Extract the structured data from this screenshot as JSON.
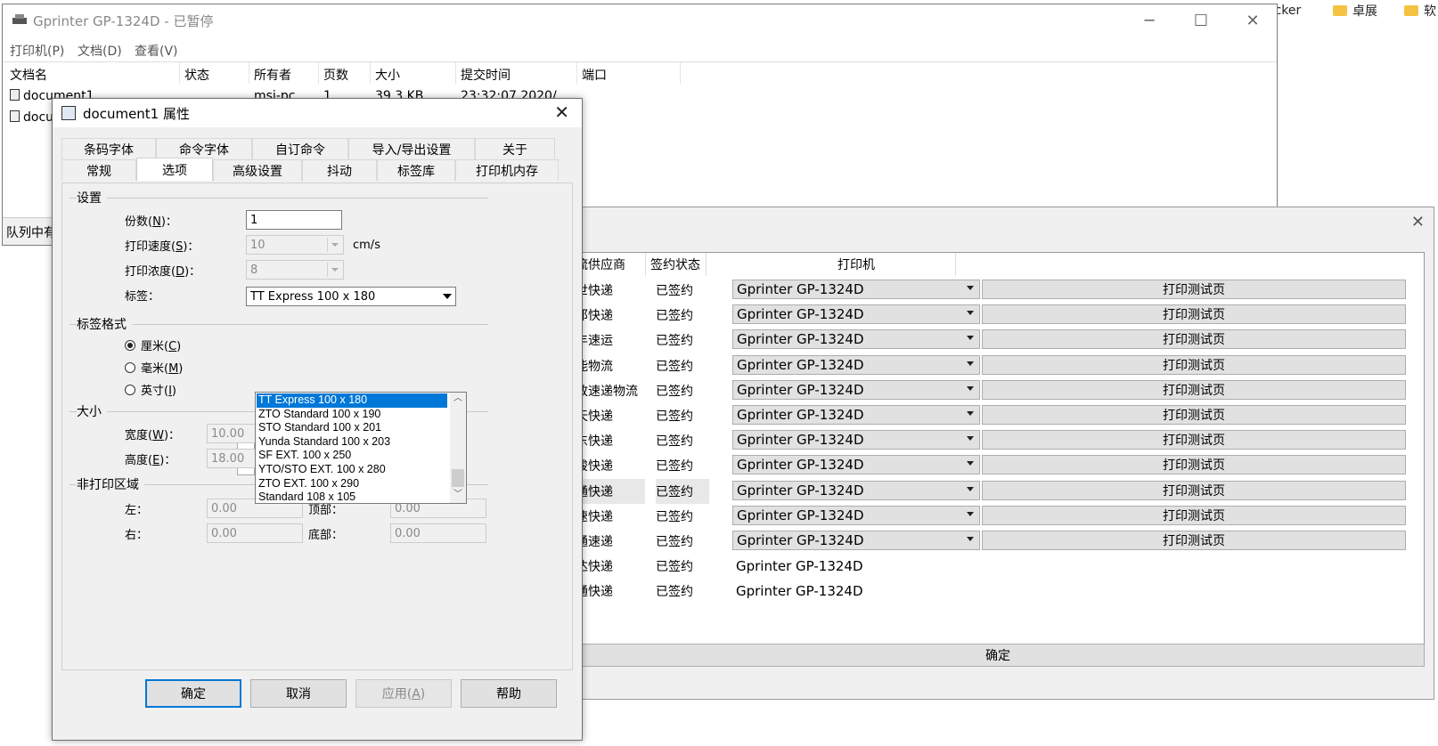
{
  "desktop": {
    "items": [
      {
        "label": "ocker"
      },
      {
        "label": "卓展"
      },
      {
        "label": "软"
      }
    ]
  },
  "queue_window": {
    "title": "Gprinter  GP-1324D - 已暂停",
    "menu": [
      "打印机(P)",
      "文档(D)",
      "查看(V)"
    ],
    "columns": [
      "文档名",
      "状态",
      "所有者",
      "页数",
      "大小",
      "提交时间",
      "端口"
    ],
    "rows": [
      {
        "name": "document1",
        "owner": "msi-pc",
        "pages": "1",
        "size": "39.3 KB",
        "time": "23:32:07  2020/"
      },
      {
        "name": "docu"
      }
    ],
    "status": "队列中有"
  },
  "bg_dialog": {
    "headers": {
      "supplier": "物流供应商",
      "status": "签约状态",
      "printer": "打印机"
    },
    "rows": [
      {
        "supplier": "百世快递",
        "status": "已签约",
        "printer": "Gprinter  GP-1324D",
        "button": "打印测试页"
      },
      {
        "supplier": "德邦快递",
        "status": "已签约",
        "printer": "Gprinter  GP-1324D",
        "button": "打印测试页"
      },
      {
        "supplier": "顺丰速运",
        "status": "已签约",
        "printer": "Gprinter  GP-1324D",
        "button": "打印测试页"
      },
      {
        "supplier": "安能物流",
        "status": "已签约",
        "printer": "Gprinter  GP-1324D",
        "button": "打印测试页"
      },
      {
        "supplier": "邮政速递物流",
        "status": "已签约",
        "printer": "Gprinter  GP-1324D",
        "button": "打印测试页"
      },
      {
        "supplier": "天天快递",
        "status": "已签约",
        "printer": "Gprinter  GP-1324D",
        "button": "打印测试页"
      },
      {
        "supplier": "京东快递",
        "status": "已签约",
        "printer": "Gprinter  GP-1324D",
        "button": "打印测试页"
      },
      {
        "supplier": "品骏快递",
        "status": "已签约",
        "printer": "Gprinter  GP-1324D",
        "button": "打印测试页"
      },
      {
        "supplier": "申通快递",
        "status": "已签约",
        "printer": "Gprinter  GP-1324D",
        "button": "打印测试页"
      },
      {
        "supplier": "优速快递",
        "status": "已签约",
        "printer": "Gprinter  GP-1324D",
        "button": "打印测试页"
      },
      {
        "supplier": "圆通速递",
        "status": "已签约",
        "printer": "Gprinter  GP-1324D",
        "button": "打印测试页"
      },
      {
        "supplier": "韵达快递",
        "status": "已签约",
        "printer": "Gprinter  GP-1324D"
      },
      {
        "supplier": "中通快递",
        "status": "已签约",
        "printer": "Gprinter  GP-1324D"
      }
    ],
    "ok": "确定"
  },
  "props": {
    "title": "document1 属性",
    "tabs_top": [
      "条码字体",
      "命令字体",
      "自订命令",
      "导入/导出设置",
      "关于"
    ],
    "tabs_bottom": [
      "常规",
      "选项",
      "高级设置",
      "抖动",
      "标签库",
      "打印机内存"
    ],
    "group_settings": "设置",
    "copies_label": "份数(",
    "copies_key": "N",
    "copies_value": "1",
    "speed_label": "打印速度(",
    "speed_key": "S",
    "speed_value": "10",
    "speed_unit": "cm/s",
    "density_label": "打印浓度(",
    "density_key": "D",
    "density_value": "8",
    "label_label": "标签：",
    "label_value": "TT Express 100 x 180",
    "label_options": [
      "TT Express 100 x 180",
      "ZTO Standard 100 x 190",
      "STO Standard 100 x 201",
      "Yunda Standard 100 x 203",
      "SF EXT. 100 x 250",
      "YTO/STO EXT. 100 x 280",
      "ZTO EXT. 100 x 290",
      "Standard 108 x 105"
    ],
    "group_format": "标签格式",
    "radio_cm": "厘米(",
    "radio_cm_key": "C",
    "radio_mm": "毫米(",
    "radio_mm_key": "M",
    "radio_in": "英寸(",
    "radio_in_key": "I",
    "group_size": "大小",
    "width_label": "宽度(",
    "width_key": "W",
    "width_value": "10.00",
    "height_label": "高度(",
    "height_key": "E",
    "height_value": "18.00",
    "group_margin": "非打印区域",
    "left_label": "左：",
    "left_value": "0.00",
    "top_label": "顶部：",
    "top_value": "0.00",
    "right_label": "右：",
    "right_value": "0.00",
    "bottom_label": "底部：",
    "bottom_value": "0.00",
    "buttons": {
      "ok": "确定",
      "cancel": "取消",
      "apply": "应用(",
      "apply_key": "A",
      "help": "帮助"
    }
  }
}
